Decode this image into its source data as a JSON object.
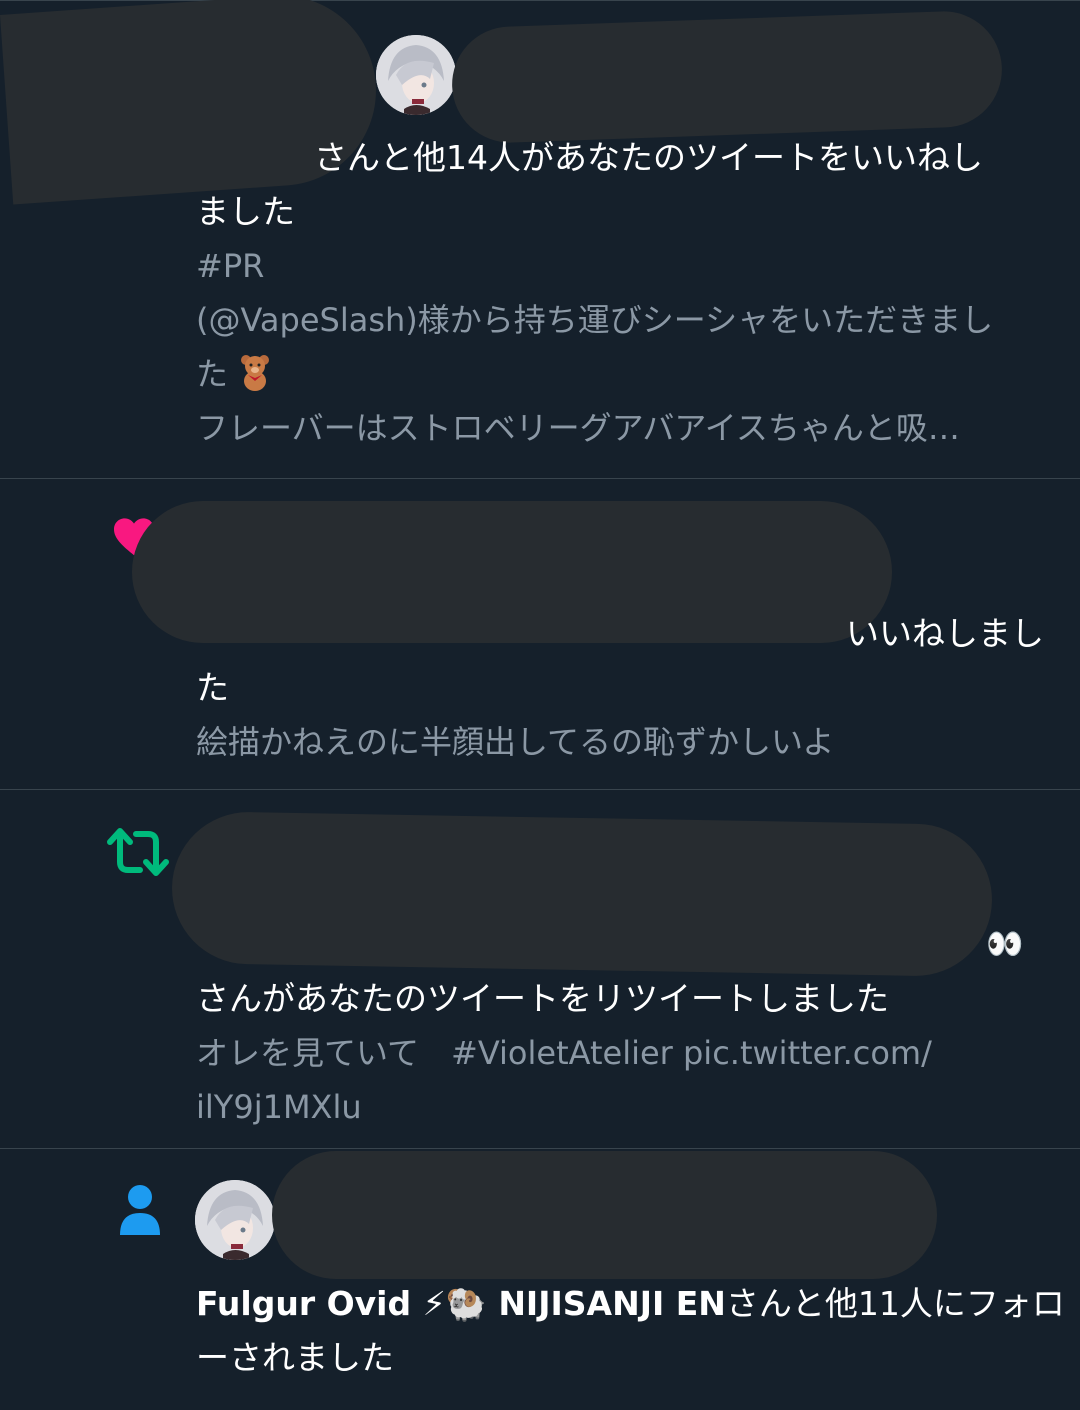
{
  "notifications": [
    {
      "type": "like",
      "icon": "heart-icon",
      "headline_tail": "さんと他14人があなたのツイートをいいねし",
      "headline_wrap": "ました",
      "tweet_lines": [
        "#PR",
        "(@VapeSlash)様から持ち運びシーシャをいただきまし",
        "た",
        "フレーバーはストロベリーグアバアイスちゃんと吸…"
      ]
    },
    {
      "type": "like",
      "icon": "heart-icon",
      "headline_tail": "いいねしまし",
      "headline_wrap": "た",
      "tweet_lines": [
        "絵描かねえのに半顔出してるの恥ずかしいよ"
      ]
    },
    {
      "type": "retweet",
      "icon": "retweet-icon",
      "name_tail_emoji": "👀",
      "headline": "さんがあなたのツイートをリツイートしました",
      "tweet_lines": [
        "オレを見ていて　#VioletAtelier pic.twitter.com/",
        "ilY9j1MXlu"
      ]
    },
    {
      "type": "follow",
      "icon": "person-icon",
      "name": "Fulgur Ovid ⚡🐏 NIJISANJI EN",
      "headline_tail": "さんと他11人にフォロ",
      "headline_wrap": "ーされました"
    }
  ],
  "colors": {
    "background": "#15202b",
    "divider": "#38444d",
    "like": "#f91880",
    "retweet": "#00ba7c",
    "follow": "#1d9bf0",
    "muted_text": "#8b98a5",
    "redaction": "#272c30"
  }
}
